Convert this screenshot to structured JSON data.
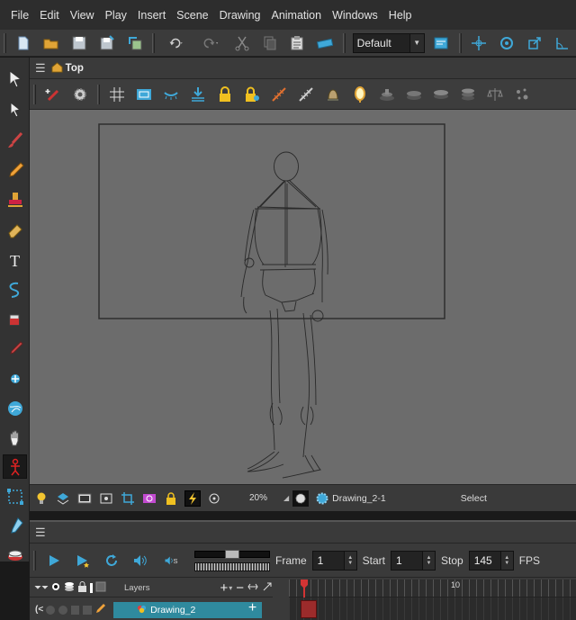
{
  "menubar": {
    "items": [
      "File",
      "Edit",
      "View",
      "Play",
      "Insert",
      "Scene",
      "Drawing",
      "Animation",
      "Windows",
      "Help"
    ]
  },
  "main_toolbar": {
    "workspace": "Default",
    "icons": [
      "new-scene-icon",
      "open-icon",
      "save-icon",
      "save-as-icon",
      "import-icon",
      "undo-icon",
      "redo-icon",
      "cut-icon",
      "copy-icon",
      "paste-icon",
      "ruler-icon",
      "export-icon",
      "transform-icon",
      "pivot-icon",
      "scale-icon",
      "rotate-icon"
    ]
  },
  "camera": {
    "breadcrumb": "Top",
    "zoom": "20%",
    "drawing_name": "Drawing_2-1",
    "tool_status": "Select"
  },
  "timeline": {
    "frame_label": "Frame",
    "frame_value": "1",
    "start_label": "Start",
    "start_value": "1",
    "stop_label": "Stop",
    "stop_value": "145",
    "fps_label": "FPS",
    "layers_header": "Layers",
    "ruler_tick": "10",
    "layers": [
      {
        "name": "Drawing_2"
      }
    ]
  },
  "colors": {
    "accent": "#3fa8d8",
    "active_layer": "#2f8a9e",
    "playhead": "#d23434",
    "frame_cell": "#9c2b2b"
  }
}
